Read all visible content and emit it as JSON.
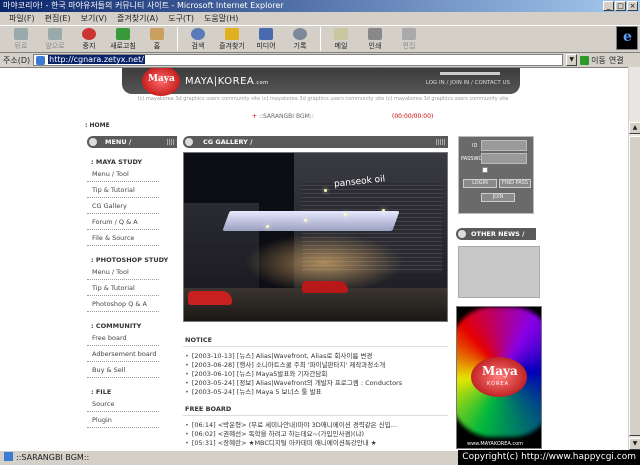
{
  "window": {
    "title": "마야코리아! - 한국 마야유저들의 커뮤니티 사이트 - Microsoft Internet Explorer"
  },
  "menu": [
    "파일(F)",
    "편집(E)",
    "보기(V)",
    "즐겨찾기(A)",
    "도구(T)",
    "도움말(H)"
  ],
  "toolbar": [
    {
      "label": "뒤로",
      "icon": "back-arrow-icon",
      "disabled": true
    },
    {
      "label": "앞으로",
      "icon": "forward-arrow-icon",
      "disabled": true
    },
    {
      "label": "중지",
      "icon": "stop-icon"
    },
    {
      "label": "새로고침",
      "icon": "refresh-icon"
    },
    {
      "label": "홈",
      "icon": "home-icon"
    },
    {
      "label": "검색",
      "icon": "search-icon"
    },
    {
      "label": "즐겨찾기",
      "icon": "favorites-icon"
    },
    {
      "label": "미디어",
      "icon": "media-icon"
    },
    {
      "label": "기록",
      "icon": "history-icon"
    },
    {
      "label": "메일",
      "icon": "mail-icon"
    },
    {
      "label": "인쇄",
      "icon": "print-icon"
    },
    {
      "label": "편집",
      "icon": "edit-icon",
      "disabled": true
    }
  ],
  "address": {
    "label": "주소(D)",
    "url": "http://cgnara.zetyx.net/",
    "go_label": "이동",
    "links_label": "연결"
  },
  "site": {
    "logo": "Maya",
    "brand": "MAYA|KOREA",
    "brand_suffix": ".com",
    "nav_links": "LOG IN / JOIN IN / CONTACT US",
    "tagline": "(c) mayakorea 3d graphics users community site (c) mayakorea 3d graphics users community site (c) mayakorea 3d graphics users community site",
    "home": ": HOME",
    "bgm": "::SARANGBI BGM::",
    "bgm_time": "(00:00/00:00)"
  },
  "left_menu": {
    "header": "MENU /",
    "sections": [
      {
        "title": ": MAYA STUDY",
        "items": [
          "Menu / Tool",
          "Tip & Tutorial",
          "CG Gallery",
          "Forum / Q & A",
          "File & Source"
        ]
      },
      {
        "title": ": PHOTOSHOP STUDY",
        "items": [
          "Menu / Tool",
          "Tip & Tutorial",
          "Photoshop Q & A"
        ]
      },
      {
        "title": ": COMMUNITY",
        "items": [
          "Free board",
          "Adbersement board",
          "Buy & Sell"
        ]
      },
      {
        "title": ": FILE",
        "items": [
          "Source",
          "Plugin"
        ]
      }
    ]
  },
  "gallery": {
    "header": "CG GALLERY /",
    "sign_text": "panseok oil"
  },
  "notice": {
    "title": "NOTICE",
    "items": [
      "[2003-10-13] [뉴스] Alias|Wavefront, Alias로 회사이름 변경",
      "[2003-06-28] [행사] 소니아트스쿨 주최 '파이널판타지' 제작과정소개",
      "[2003-06-10] [뉴스] Maya5발표와 기자간담회",
      "[2003-05-24] [정보] Alias|Wavefront의 개발자 프로그램 : Conductors",
      "[2003-05-24] [뉴스] Maya 5 보너스 툴 발표"
    ]
  },
  "freeboard": {
    "title": "FREE BOARD",
    "items": [
      "[06:14] <박운형> (무료 세미나안내)마야 3D애니메이션 경력같은 신입...",
      "[06:02] <권혜선> 독학을 하려고 하는데요~(가입인사겸)(냐)",
      "[05:31] <장혜란> ★MBC디지털 아카데미 애니메이션특강안내 ★"
    ]
  },
  "login": {
    "id_label": "ID",
    "pw_label": "PASSWORD",
    "login_btn": "LOGIN",
    "find_btn": "FIND PASS",
    "join_btn": "JOIN"
  },
  "other_news": {
    "header": "OTHER NEWS /"
  },
  "ad": {
    "logo": "Maya",
    "sub": "KOREA",
    "url": "www.MAYAKOREA.com"
  },
  "status": {
    "text": "::SARANGBI BGM::",
    "copyright": "Copyright(c) http://www.happycgi.com"
  }
}
